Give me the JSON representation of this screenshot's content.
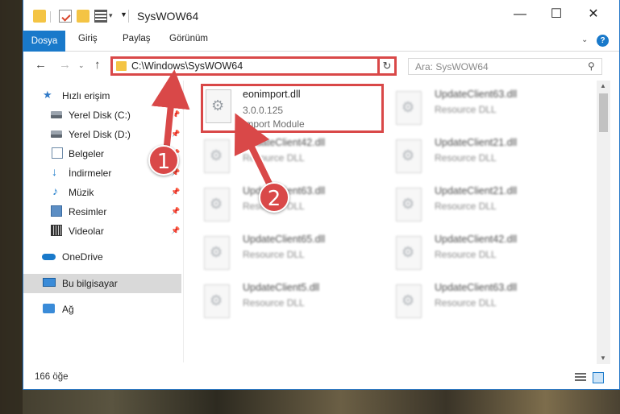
{
  "window": {
    "title": "SysWOW64",
    "min_glyph": "—",
    "max_glyph": "☐",
    "close_glyph": "✕"
  },
  "ribbon": {
    "tabs": [
      "Dosya",
      "Giriş",
      "Paylaş",
      "Görünüm"
    ],
    "help_glyph": "?",
    "collapse_glyph": "⌄"
  },
  "nav": {
    "back_glyph": "←",
    "forward_glyph": "→",
    "recent_glyph": "⌄",
    "up_glyph": "↑",
    "address": "C:\\Windows\\SysWOW64",
    "address_dd_glyph": "⌄",
    "refresh_glyph": "↻",
    "search_placeholder": "Ara: SysWOW64",
    "search_glyph": "⚲"
  },
  "sidebar": {
    "items": [
      {
        "label": "Hızlı erişim",
        "icon": "star-icon",
        "pinned": false
      },
      {
        "label": "Yerel Disk (C:)",
        "icon": "drive-icon",
        "pinned": true
      },
      {
        "label": "Yerel Disk (D:)",
        "icon": "drive-icon",
        "pinned": true
      },
      {
        "label": "Belgeler",
        "icon": "documents-icon",
        "pinned": true
      },
      {
        "label": "İndirmeler",
        "icon": "downloads-icon",
        "pinned": true
      },
      {
        "label": "Müzik",
        "icon": "music-icon",
        "pinned": true
      },
      {
        "label": "Resimler",
        "icon": "pictures-icon",
        "pinned": true
      },
      {
        "label": "Videolar",
        "icon": "videos-icon",
        "pinned": true
      },
      {
        "label": "OneDrive",
        "icon": "onedrive-icon",
        "pinned": false
      },
      {
        "label": "Bu bilgisayar",
        "icon": "this-pc-icon",
        "pinned": false,
        "selected": true
      },
      {
        "label": "Ağ",
        "icon": "network-icon",
        "pinned": false
      }
    ]
  },
  "files": [
    {
      "name": "eonimport.dll",
      "version": "3.0.0.125",
      "type": "Import Module",
      "highlighted": true
    },
    {
      "name": "UpdateClient63.dll",
      "type": "Resource DLL"
    },
    {
      "name": "UpdateClient42.dll",
      "type": "Resource DLL"
    },
    {
      "name": "UpdateClient21.dll",
      "type": "Resource DLL"
    },
    {
      "name": "UpdateClient63.dll",
      "type": "Resource DLL"
    },
    {
      "name": "UpdateClient21.dll",
      "type": "Resource DLL"
    },
    {
      "name": "UpdateClient65.dll",
      "type": "Resource DLL"
    },
    {
      "name": "UpdateClient42.dll",
      "type": "Resource DLL"
    },
    {
      "name": "UpdateClient5.dll",
      "type": "Resource DLL"
    },
    {
      "name": "UpdateClient63.dll",
      "type": "Resource DLL"
    }
  ],
  "status": {
    "item_count": "166 öğe"
  },
  "callouts": [
    "1",
    "2"
  ],
  "colors": {
    "accent": "#1979ca",
    "highlight_red": "#d94848"
  }
}
